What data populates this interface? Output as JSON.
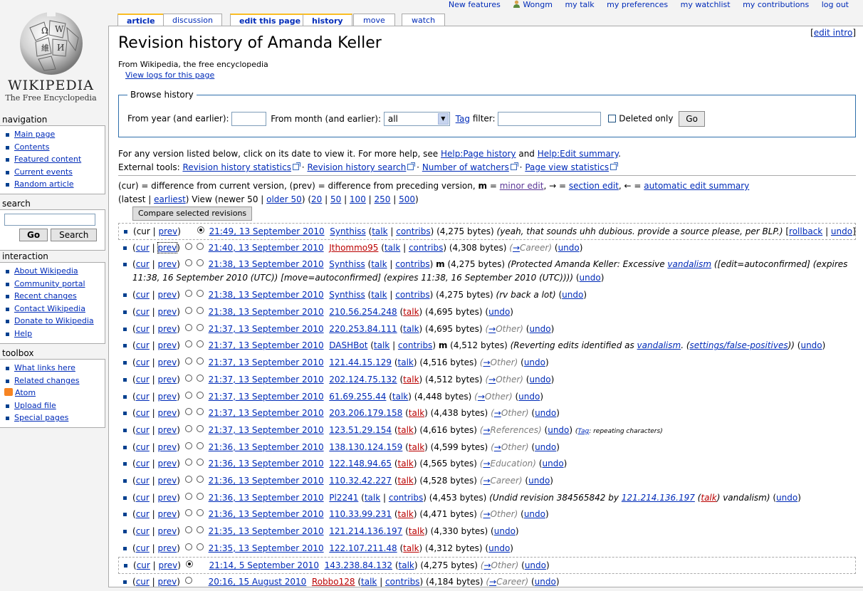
{
  "personal_tools": {
    "new_features": "New features",
    "user": "Wongm",
    "my_talk": "my talk",
    "my_preferences": "my preferences",
    "my_watchlist": "my watchlist",
    "my_contributions": "my contributions",
    "log_out": "log out"
  },
  "tabs": {
    "article": "article",
    "discussion": "discussion",
    "edit": "edit this page",
    "history": "history",
    "move": "move",
    "watch": "watch"
  },
  "logo": {
    "title": "Wikipedia",
    "subtitle": "The Free Encyclopedia"
  },
  "navigation": {
    "heading": "navigation",
    "items": [
      "Main page",
      "Contents",
      "Featured content",
      "Current events",
      "Random article"
    ]
  },
  "search": {
    "heading": "search",
    "value": "",
    "go": "Go",
    "search": "Search"
  },
  "interaction": {
    "heading": "interaction",
    "items": [
      "About Wikipedia",
      "Community portal",
      "Recent changes",
      "Contact Wikipedia",
      "Donate to Wikipedia",
      "Help"
    ]
  },
  "toolbox": {
    "heading": "toolbox",
    "items": [
      "What links here",
      "Related changes",
      "Atom",
      "Upload file",
      "Special pages"
    ]
  },
  "page": {
    "edit_intro": "edit intro",
    "title": "Revision history of Amanda Keller",
    "from": "From Wikipedia, the free encyclopedia",
    "view_logs": "View logs for this page"
  },
  "browse": {
    "legend": "Browse history",
    "from_year": "From year (and earlier):",
    "year_value": "",
    "from_month": "From month (and earlier):",
    "month_value": "all",
    "tag": "Tag",
    "filter": " filter:",
    "tag_value": "",
    "deleted_only": "Deleted only",
    "go": "Go"
  },
  "intro": {
    "line1_a": "For any version listed below, click on its date to view it. For more help, see ",
    "help_page_history": "Help:Page history",
    "and": " and ",
    "help_edit_summary": "Help:Edit summary",
    "period": ".",
    "external_tools": "External tools: ",
    "tools": [
      "Revision history statistics",
      "Revision history search",
      "Number of watchers",
      "Page view statistics"
    ]
  },
  "legend": {
    "a": "(cur) = difference from current version, (prev) = difference from preceding version, ",
    "m": "m",
    "eq1": " = ",
    "minor_edit": "minor edit",
    "arrow1": ", → = ",
    "section_edit": "section edit",
    "arrow2": ", ← = ",
    "auto_summary": "automatic edit summary"
  },
  "nav": {
    "latest": "(latest | ",
    "earliest": "earliest",
    "view": ") View (newer 50 | ",
    "older": "older 50",
    "sizes_open": ") (",
    "n20": "20",
    "n50": "50",
    "n100": "100",
    "n250": "250",
    "n500": "500",
    "close": ")"
  },
  "compare_button": "Compare selected revisions",
  "revisions": [
    {
      "date": "21:49, 13 September 2010",
      "user": "Synthiss",
      "talk": "talk",
      "contribs": "contribs",
      "bytes": "(4,275 bytes)",
      "summary": "(yeah, that sounds uhh dubious. provide a source please, per BLP.)",
      "rollback": "rollback",
      "undo": "undo"
    },
    {
      "date": "21:40, 13 September 2010",
      "user": "Jthommo95",
      "talk": "talk",
      "contribs": "contribs",
      "bytes": "(4,308 bytes)",
      "section": "Career",
      "undo": "undo"
    },
    {
      "date": "21:38, 13 September 2010",
      "user": "Synthiss",
      "talk": "talk",
      "contribs": "contribs",
      "minor": "m",
      "bytes": "(4,275 bytes)",
      "summary_a": "(Protected Amanda Keller: Excessive ",
      "vandalism": "vandalism",
      "summary_b": " ([edit=autoconfirmed] (expires 11:38, 16 September 2010 (UTC)) [move=autoconfirmed] (expires 11:38, 16 September 2010 (UTC))))",
      "undo": "undo"
    },
    {
      "date": "21:38, 13 September 2010",
      "user": "Synthiss",
      "talk": "talk",
      "contribs": "contribs",
      "bytes": "(4,275 bytes)",
      "summary": "(rv back a lot)",
      "undo": "undo"
    },
    {
      "date": "21:38, 13 September 2010",
      "user": "210.56.254.248",
      "talk": "talk",
      "bytes": "(4,695 bytes)",
      "undo": "undo"
    },
    {
      "date": "21:37, 13 September 2010",
      "user": "220.253.84.111",
      "talk": "talk",
      "bytes": "(4,695 bytes)",
      "section": "Other",
      "undo": "undo"
    },
    {
      "date": "21:37, 13 September 2010",
      "user": "DASHBot",
      "talk": "talk",
      "contribs": "contribs",
      "minor": "m",
      "bytes": "(4,512 bytes)",
      "summary_a": "(Reverting edits identified as ",
      "vandalism": "vandalism",
      "summary_b": ". (",
      "settings": "settings/false-positives",
      "summary_c": "))",
      "undo": "undo"
    },
    {
      "date": "21:37, 13 September 2010",
      "user": "121.44.15.129",
      "talk": "talk",
      "bytes": "(4,516 bytes)",
      "section": "Other",
      "undo": "undo"
    },
    {
      "date": "21:37, 13 September 2010",
      "user": "202.124.75.132",
      "talk": "talk",
      "bytes": "(4,512 bytes)",
      "section": "Other",
      "undo": "undo"
    },
    {
      "date": "21:37, 13 September 2010",
      "user": "61.69.255.44",
      "talk": "talk",
      "bytes": "(4,448 bytes)",
      "section": "Other",
      "undo": "undo"
    },
    {
      "date": "21:37, 13 September 2010",
      "user": "203.206.179.158",
      "talk": "talk",
      "bytes": "(4,438 bytes)",
      "section": "Other",
      "undo": "undo"
    },
    {
      "date": "21:37, 13 September 2010",
      "user": "123.51.29.154",
      "talk": "talk",
      "bytes": "(4,616 bytes)",
      "section": "References",
      "undo": "undo",
      "tag_label": "Tag",
      "tag_value": ": repeating characters"
    },
    {
      "date": "21:36, 13 September 2010",
      "user": "138.130.124.159",
      "talk": "talk",
      "bytes": "(4,599 bytes)",
      "section": "Other",
      "undo": "undo"
    },
    {
      "date": "21:36, 13 September 2010",
      "user": "122.148.94.65",
      "talk": "talk",
      "bytes": "(4,565 bytes)",
      "section": "Education",
      "undo": "undo"
    },
    {
      "date": "21:36, 13 September 2010",
      "user": "110.32.42.227",
      "talk": "talk",
      "bytes": "(4,528 bytes)",
      "section": "Career",
      "undo": "undo"
    },
    {
      "date": "21:36, 13 September 2010",
      "user": "Pl2241",
      "talk": "talk",
      "contribs": "contribs",
      "bytes": "(4,453 bytes)",
      "summary_a": "(Undid revision 384565842 by ",
      "ip": "121.214.136.197",
      "summary_b": " (",
      "ip_talk": "talk",
      "summary_c": ") vandalism)",
      "undo": "undo"
    },
    {
      "date": "21:36, 13 September 2010",
      "user": "110.33.99.231",
      "talk": "talk",
      "bytes": "(4,471 bytes)",
      "section": "Other",
      "undo": "undo"
    },
    {
      "date": "21:35, 13 September 2010",
      "user": "121.214.136.197",
      "talk": "talk",
      "bytes": "(4,330 bytes)",
      "undo": "undo"
    },
    {
      "date": "21:35, 13 September 2010",
      "user": "122.107.211.48",
      "talk": "talk",
      "bytes": "(4,312 bytes)",
      "undo": "undo"
    },
    {
      "date": "21:14, 5 September 2010",
      "user": "143.238.84.132",
      "talk": "talk",
      "bytes": "(4,275 bytes)",
      "section": "Other",
      "undo": "undo"
    },
    {
      "date": "20:16, 15 August 2010",
      "user": "Robbo128",
      "talk": "talk",
      "contribs": "contribs",
      "bytes": "(4,184 bytes)",
      "section": "Career",
      "undo": "undo"
    }
  ],
  "rev_common": {
    "cur": "cur",
    "prev": "prev"
  },
  "colors": {
    "link": "#002bb8",
    "redlink": "#ba0000",
    "tab_highlight": "#fabd23",
    "box_border": "#2f6fab"
  }
}
